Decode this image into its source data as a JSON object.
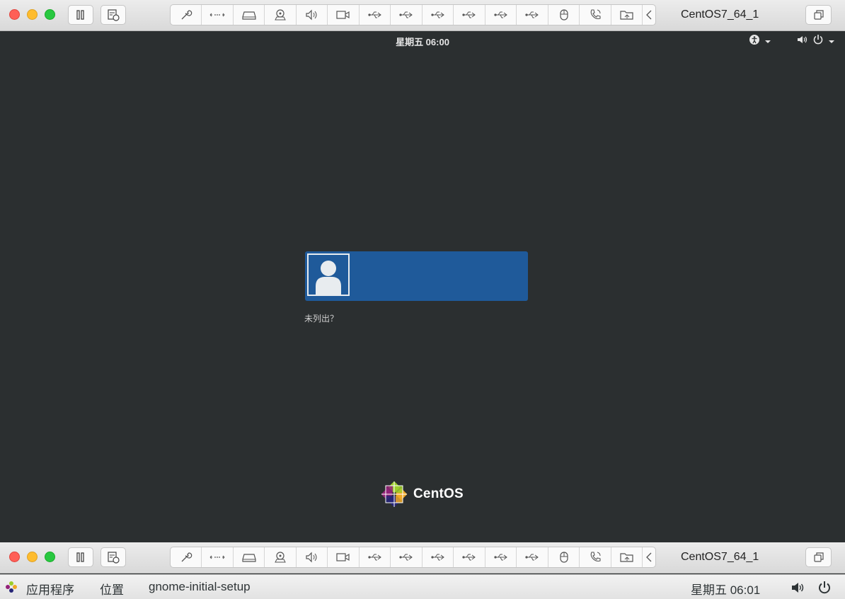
{
  "vm_window": {
    "title": "CentOS7_64_1"
  },
  "toolbar": {
    "devices": [
      "settings-icon",
      "network-icon",
      "disk-icon",
      "camera-icon",
      "sound-icon",
      "video-icon",
      "usb-icon",
      "usb-icon",
      "usb-icon",
      "usb-icon",
      "usb-icon",
      "usb-icon",
      "mouse-icon",
      "phone-icon",
      "shared-folder-icon",
      "chevron-left-icon"
    ]
  },
  "gnome": {
    "clock": "星期五 06:00"
  },
  "login": {
    "not_listed": "未列出？"
  },
  "logo": {
    "text": "CentOS"
  },
  "taskbar": {
    "applications": "应用程序",
    "places": "位置",
    "window_name": "gnome-initial-setup",
    "clock": "星期五 06:01"
  },
  "colors": {
    "screen_bg": "#2b2f30",
    "user_card": "#1f5a9a",
    "toolbar_bg": "#e3e3e3"
  }
}
